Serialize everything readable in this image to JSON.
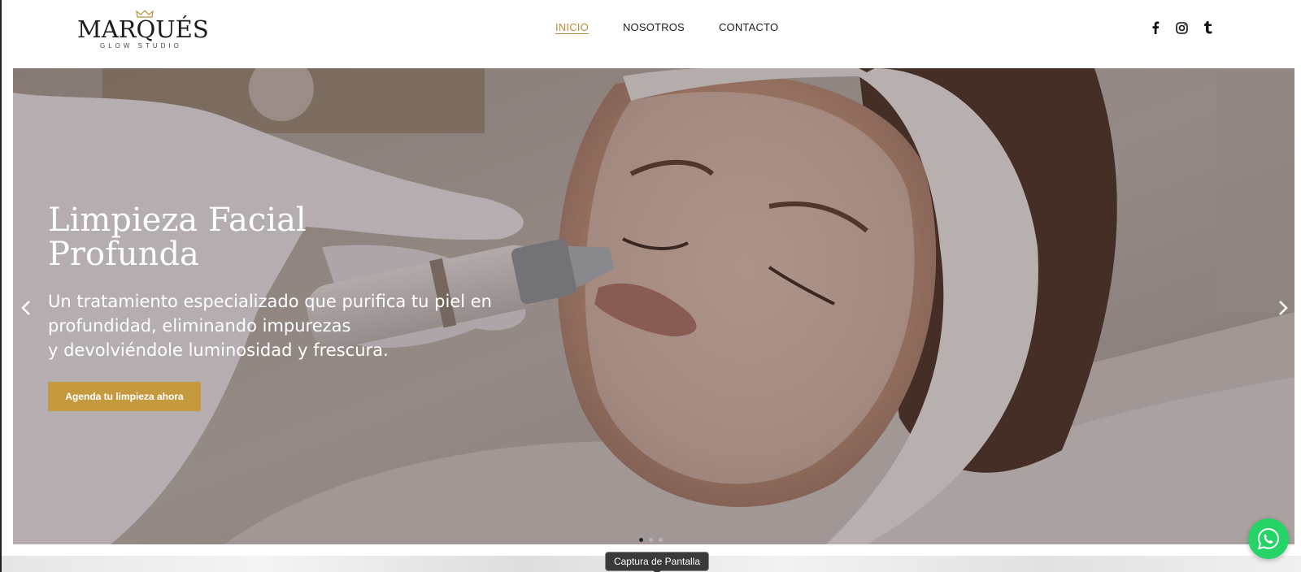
{
  "brand": {
    "name": "MARQUÉS",
    "tagline": "GLOW STUDIO"
  },
  "nav": {
    "items": [
      {
        "label": "INICIO",
        "active": true
      },
      {
        "label": "NOSOTROS",
        "active": false
      },
      {
        "label": "CONTACTO",
        "active": false
      }
    ]
  },
  "social": {
    "icons": [
      "facebook-icon",
      "instagram-icon",
      "tumblr-icon"
    ]
  },
  "hero": {
    "title_line1": "Limpieza Facial",
    "title_line2": "Profunda",
    "text_line1": "Un tratamiento especializado que purifica tu piel en",
    "text_line2": "profundidad, eliminando impurezas",
    "text_line3": "y devolviéndole luminosidad y frescura.",
    "cta_label": "Agenda tu limpieza ahora",
    "slides": 3,
    "active_slide": 1
  },
  "tooltip": {
    "label": "Captura de Pantalla"
  },
  "colors": {
    "accent": "#c59a3f",
    "nav_active": "#b58d3e",
    "whatsapp": "#25d366"
  }
}
